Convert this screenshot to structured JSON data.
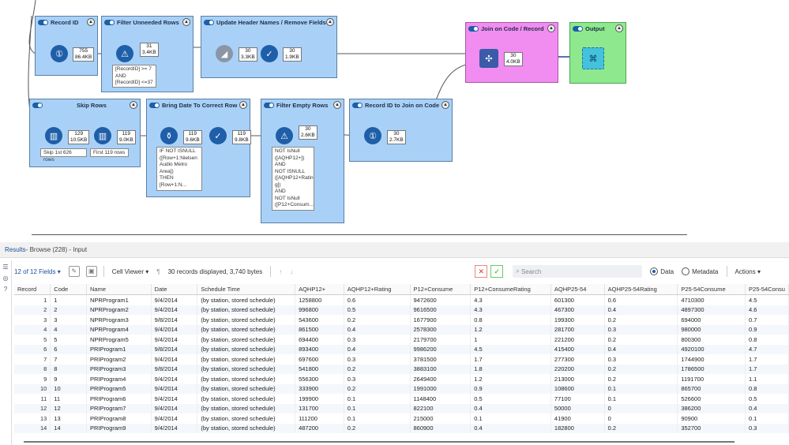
{
  "canvas": {
    "containers": {
      "record_id": "Record ID",
      "filter_unneeded": "Filter Unneeded Rows",
      "update_header": "Update Header Names / Remove Fields",
      "join": "Join on Code / Record",
      "output": "Output",
      "skip_rows": "Skip Rows",
      "bring_date": "Bring Date To Correct Row",
      "filter_empty": "Filter Empty Rows",
      "record_id_join": "Record ID to Join on Code"
    },
    "badges": {
      "b1": [
        "755",
        "86.4KB"
      ],
      "b2": [
        "31",
        "3.4KB"
      ],
      "b3": [
        "30",
        "3.3KB"
      ],
      "b4": [
        "30",
        "1.9KB"
      ],
      "b5": [
        "30",
        "4.0KB"
      ],
      "b6": [
        "129",
        "10.5KB"
      ],
      "b7": [
        "119",
        "9.0KB"
      ],
      "b8": [
        "119",
        "9.6KB"
      ],
      "b9": [
        "119",
        "9.8KB"
      ],
      "b10": [
        "30",
        "2.6KB"
      ],
      "b11": [
        "30",
        "2.7KB"
      ]
    },
    "notes": {
      "filter_expr": "[RecordID] >= 7\nAND\n[RecordID] <=37",
      "skip": "Skip 1st 626 rows",
      "first": "First 119 rows",
      "date_expr": "IF NOT ISNULL\n([Row+1:Nielsen\nAudio Metro\nArea])\nTHEN\n[Row+1:N...",
      "empty_expr": "NOT IsNull\n([AQHP12+])\nAND\nNOT ISNULL\n([AQHP12+Ratin\ng])\nAND\nNOT IsNull\n([P12+Consum..."
    }
  },
  "results": {
    "title": "Results",
    "subtitle": " - Browse (228) - Input"
  },
  "toolbar": {
    "fields": "12 of 12 Fields",
    "viewer": "Cell Viewer",
    "summary": "30 records displayed, 3,740 bytes",
    "search_placeholder": "Search",
    "data_label": "Data",
    "metadata_label": "Metadata",
    "actions_label": "Actions"
  },
  "colors": {
    "container_blue": "#a9d1f7",
    "container_pink": "#f18cf0",
    "container_green": "#8ee98e",
    "tool_blue": "#1f5ea8",
    "wire": "#555555",
    "wire_join": "#2a3c9a"
  },
  "table": {
    "columns": [
      "Record",
      "Code",
      "Name",
      "Date",
      "Schedule Time",
      "AQHP12+",
      "AQHP12+Rating",
      "P12+Consume",
      "P12+ConsumeRating",
      "AQHP25-54",
      "AQHP25-54Rating",
      "P25-54Consume",
      "P25-54Consu"
    ],
    "rows": [
      [
        "1",
        "1",
        "NPRProgram1",
        "9/4/2014",
        "(by station, stored schedule)",
        "1258800",
        "0.6",
        "9472600",
        "4.3",
        "601300",
        "0.6",
        "4710300",
        "4.5"
      ],
      [
        "2",
        "2",
        "NPRProgram2",
        "9/4/2014",
        "(by station, stored schedule)",
        "996800",
        "0.5",
        "9616500",
        "4.3",
        "467300",
        "0.4",
        "4897300",
        "4.6"
      ],
      [
        "3",
        "3",
        "NPRProgram3",
        "9/8/2014",
        "(by station, stored schedule)",
        "543600",
        "0.2",
        "1677900",
        "0.8",
        "199300",
        "0.2",
        "694000",
        "0.7"
      ],
      [
        "4",
        "4",
        "NPRProgram4",
        "9/4/2014",
        "(by station, stored schedule)",
        "861500",
        "0.4",
        "2578300",
        "1.2",
        "281700",
        "0.3",
        "980000",
        "0.9"
      ],
      [
        "5",
        "5",
        "NPRProgram5",
        "9/4/2014",
        "(by station, stored schedule)",
        "694400",
        "0.3",
        "2179700",
        "1",
        "221200",
        "0.2",
        "800300",
        "0.8"
      ],
      [
        "6",
        "6",
        "PRIProgram1",
        "9/8/2014",
        "(by station, stored schedule)",
        "893400",
        "0.4",
        "9986200",
        "4.5",
        "415400",
        "0.4",
        "4920100",
        "4.7"
      ],
      [
        "7",
        "7",
        "PRIProgram2",
        "9/4/2014",
        "(by station, stored schedule)",
        "697600",
        "0.3",
        "3781500",
        "1.7",
        "277300",
        "0.3",
        "1744900",
        "1.7"
      ],
      [
        "8",
        "8",
        "PRIProgram3",
        "9/8/2014",
        "(by station, stored schedule)",
        "541800",
        "0.2",
        "3883100",
        "1.8",
        "220200",
        "0.2",
        "1786500",
        "1.7"
      ],
      [
        "9",
        "9",
        "PRIProgram4",
        "9/4/2014",
        "(by station, stored schedule)",
        "556300",
        "0.3",
        "2649400",
        "1.2",
        "213000",
        "0.2",
        "1191700",
        "1.1"
      ],
      [
        "10",
        "10",
        "PRIProgram5",
        "9/4/2014",
        "(by station, stored schedule)",
        "333900",
        "0.2",
        "1991000",
        "0.9",
        "108600",
        "0.1",
        "865700",
        "0.8"
      ],
      [
        "11",
        "11",
        "PRIProgram6",
        "9/4/2014",
        "(by station, stored schedule)",
        "199900",
        "0.1",
        "1148400",
        "0.5",
        "77100",
        "0.1",
        "526600",
        "0.5"
      ],
      [
        "12",
        "12",
        "PRIProgram7",
        "9/4/2014",
        "(by station, stored schedule)",
        "131700",
        "0.1",
        "822100",
        "0.4",
        "50000",
        "0",
        "386200",
        "0.4"
      ],
      [
        "13",
        "13",
        "PRIProgram8",
        "9/4/2014",
        "(by station, stored schedule)",
        "111200",
        "0.1",
        "215000",
        "0.1",
        "41900",
        "0",
        "90900",
        "0.1"
      ],
      [
        "14",
        "14",
        "PRIProgram9",
        "9/4/2014",
        "(by station, stored schedule)",
        "487200",
        "0.2",
        "860900",
        "0.4",
        "182800",
        "0.2",
        "352700",
        "0.3"
      ]
    ]
  }
}
